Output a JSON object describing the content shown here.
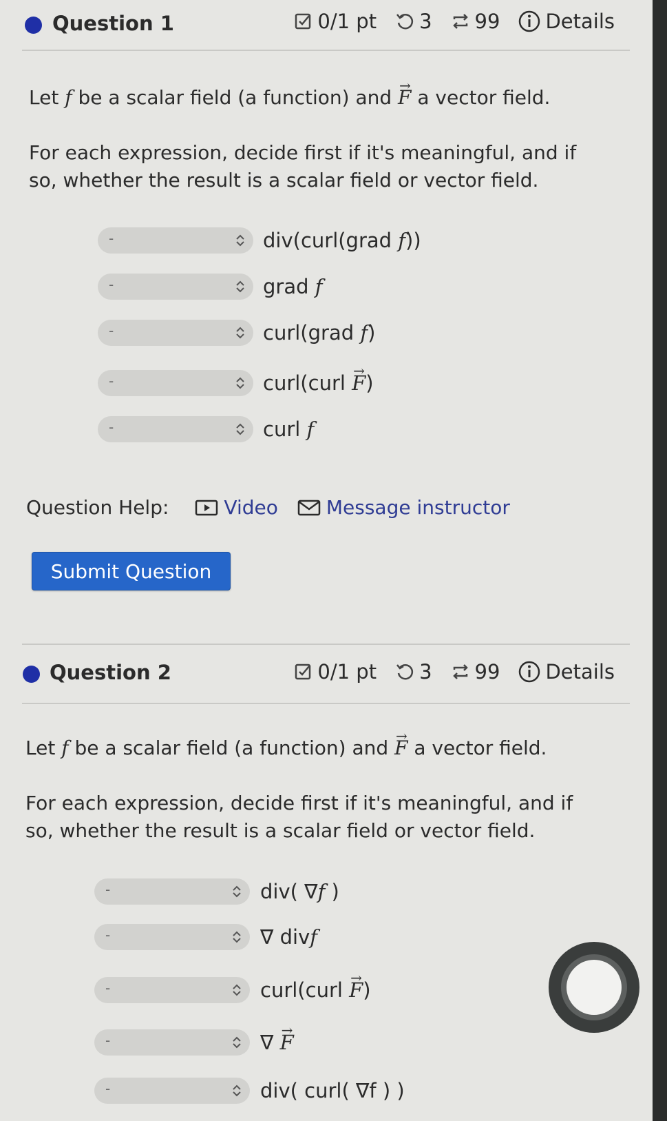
{
  "questions": [
    {
      "title": "Question 1",
      "points": "0/1 pt",
      "retries": "3",
      "attempts": "99",
      "details": "Details",
      "prompt_part1_a": "Let ",
      "prompt_part1_f": "f",
      "prompt_part1_b": " be a scalar field (a function) and ",
      "prompt_part1_F": "F",
      "prompt_part1_c": " a vector field.",
      "prompt_part2": "For each expression, decide first if it's meaningful, and if so, whether the result is a scalar field or vector field.",
      "rows": [
        {
          "select_value": "-",
          "expr_a": "div(curl(grad ",
          "expr_var": "f",
          "expr_b": "))",
          "vec": false
        },
        {
          "select_value": "-",
          "expr_a": "grad ",
          "expr_var": "f",
          "expr_b": "",
          "vec": false
        },
        {
          "select_value": "-",
          "expr_a": "curl(grad ",
          "expr_var": "f",
          "expr_b": ")",
          "vec": false
        },
        {
          "select_value": "-",
          "expr_a": "curl(curl ",
          "expr_var": "F",
          "expr_b": ")",
          "vec": true
        },
        {
          "select_value": "-",
          "expr_a": "curl ",
          "expr_var": "f",
          "expr_b": "",
          "vec": false
        }
      ]
    },
    {
      "title": "Question 2",
      "points": "0/1 pt",
      "retries": "3",
      "attempts": "99",
      "details": "Details",
      "prompt_part1_a": "Let ",
      "prompt_part1_f": "f",
      "prompt_part1_b": " be a scalar field (a function) and ",
      "prompt_part1_F": "F",
      "prompt_part1_c": " a vector field.",
      "prompt_part2": "For each expression, decide first if it's meaningful, and if so, whether the result is a scalar field or vector field.",
      "rows": [
        {
          "select_value": "-",
          "expr_a": "div( ∇",
          "expr_var": "f",
          "expr_b": " )",
          "vec": false
        },
        {
          "select_value": "-",
          "expr_a": "∇ div",
          "expr_var": "f",
          "expr_b": "",
          "vec": false
        },
        {
          "select_value": "-",
          "expr_a": "curl(curl ",
          "expr_var": "F",
          "expr_b": ")",
          "vec": true
        },
        {
          "select_value": "-",
          "expr_a": "∇ ",
          "expr_var": "F",
          "expr_b": "",
          "vec": true
        },
        {
          "select_value": "-",
          "expr_a": "div( curl( ∇f ) )",
          "expr_var": "",
          "expr_b": "",
          "vec": false
        }
      ]
    }
  ],
  "help": {
    "label": "Question Help:",
    "video": "Video",
    "message": "Message instructor"
  },
  "submit_label": "Submit Question",
  "colors": {
    "accent": "#2666c9",
    "dot": "#1f2fa6",
    "link": "#2f3c94"
  }
}
